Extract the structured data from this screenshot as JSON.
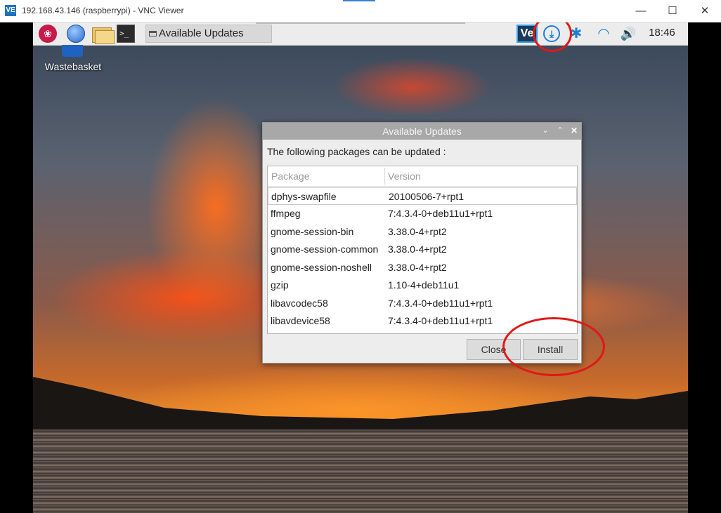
{
  "host_window": {
    "title": "192.168.43.146 (raspberrypi) - VNC Viewer",
    "icon_text": "VE",
    "controls": {
      "minimize": "—",
      "maximize": "☐",
      "close": "✕"
    }
  },
  "panel": {
    "menu_logo": "❀",
    "terminal_prompt": ">_",
    "taskbar_window_title": "Available Updates",
    "tray": {
      "vnc_label": "Ve",
      "update_symbol": "⤓",
      "bluetooth_symbol": "✱",
      "wifi_symbol": "◠",
      "volume_symbol": "🔊",
      "clock": "18:46"
    }
  },
  "desktop": {
    "wastebasket_label": "Wastebasket"
  },
  "dialog": {
    "title": "Available Updates",
    "controls": {
      "minimize": "⌄",
      "maximize": "⌃",
      "close": "✕"
    },
    "message": "The following packages can be updated :",
    "columns": {
      "package": "Package",
      "version": "Version"
    },
    "packages": [
      {
        "name": "dphys-swapfile",
        "version": "20100506-7+rpt1"
      },
      {
        "name": "ffmpeg",
        "version": "7:4.3.4-0+deb11u1+rpt1"
      },
      {
        "name": "gnome-session-bin",
        "version": "3.38.0-4+rpt2"
      },
      {
        "name": "gnome-session-common",
        "version": "3.38.0-4+rpt2"
      },
      {
        "name": "gnome-session-noshell",
        "version": "3.38.0-4+rpt2"
      },
      {
        "name": "gzip",
        "version": "1.10-4+deb11u1"
      },
      {
        "name": "libavcodec58",
        "version": "7:4.3.4-0+deb11u1+rpt1"
      },
      {
        "name": "libavdevice58",
        "version": "7:4.3.4-0+deb11u1+rpt1"
      }
    ],
    "buttons": {
      "close": "Close",
      "install": "Install"
    }
  },
  "colors": {
    "annotation": "#e01818",
    "tray_accent": "#1e7fd2",
    "rpi_red": "#c51a4a"
  }
}
